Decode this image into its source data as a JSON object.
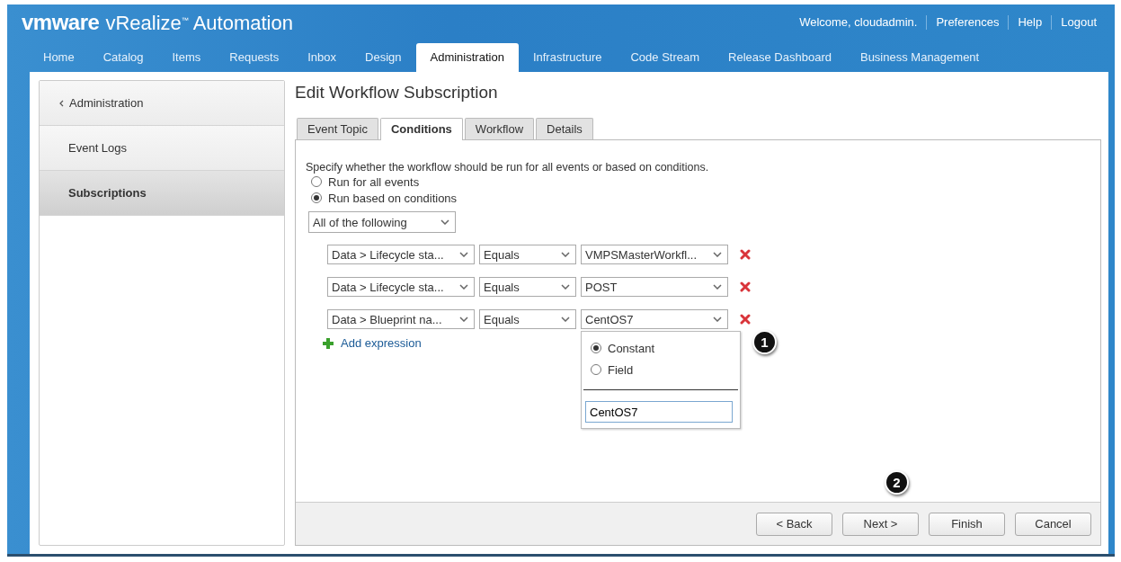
{
  "header": {
    "brand": "vmware",
    "product": "vRealize$^{™}$ Automation",
    "links": [
      "Welcome, cloudadmin.",
      "Preferences",
      "Help",
      "Logout"
    ]
  },
  "nav": [
    {
      "label": "Home",
      "selected": false
    },
    {
      "label": "Catalog",
      "selected": false
    },
    {
      "label": "Items",
      "selected": false
    },
    {
      "label": "Requests",
      "selected": false
    },
    {
      "label": "Inbox",
      "selected": false
    },
    {
      "label": "Design",
      "selected": false
    },
    {
      "label": "Administration",
      "selected": true
    },
    {
      "label": "Infrastructure",
      "selected": false
    },
    {
      "label": "Code Stream",
      "selected": false
    },
    {
      "label": "Release Dashboard",
      "selected": false
    },
    {
      "label": "Business Management",
      "selected": false
    }
  ],
  "sidebar": {
    "items": [
      {
        "label": "Administration",
        "kind": "back",
        "selected": false
      },
      {
        "label": "Event Logs",
        "kind": "link",
        "selected": false
      },
      {
        "label": "Subscriptions",
        "kind": "link",
        "selected": true
      }
    ]
  },
  "page_title": "Edit Workflow Subscription",
  "tabs": [
    {
      "label": "Event Topic",
      "selected": false
    },
    {
      "label": "Conditions",
      "selected": true
    },
    {
      "label": "Workflow",
      "selected": false
    },
    {
      "label": "Details",
      "selected": false
    }
  ],
  "instruction": "Specify whether the workflow should be run for all events or based on conditions.",
  "run_options": [
    {
      "label": "Run for all events",
      "selected": false
    },
    {
      "label": "Run based on conditions",
      "selected": true
    }
  ],
  "match_select": "All of the following",
  "conditions": [
    {
      "field": "Data > Lifecycle sta...",
      "operator": "Equals",
      "value": "VMPSMasterWorkfl..."
    },
    {
      "field": "Data > Lifecycle sta...",
      "operator": "Equals",
      "value": "POST"
    },
    {
      "field": "Data > Blueprint na...",
      "operator": "Equals",
      "value": "CentOS7"
    }
  ],
  "value_popup": {
    "options": [
      {
        "label": "Constant",
        "selected": true
      },
      {
        "label": "Field",
        "selected": false
      }
    ],
    "input": "CentOS7"
  },
  "add_expression": "Add expression",
  "buttons": [
    "< Back",
    "Next >",
    "Finish",
    "Cancel"
  ],
  "callouts": [
    "1",
    "2"
  ]
}
